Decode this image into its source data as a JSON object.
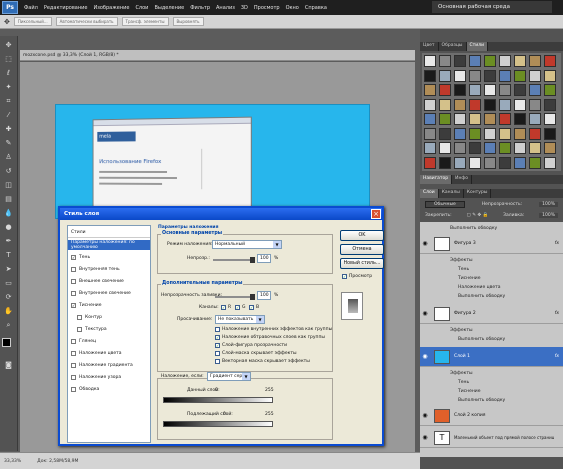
{
  "menubar": {
    "logo": "Ps",
    "items": [
      "Файл",
      "Редактирование",
      "Изображение",
      "Слои",
      "Выделение",
      "Фильтр",
      "Анализ",
      "3D",
      "Просмотр",
      "Окно",
      "Справка"
    ],
    "workspace": "Основная рабочая среда"
  },
  "options": {
    "items": [
      "Пиксельный...",
      "Автоматически выбирать",
      "Трансф. элементы",
      "Выровнять"
    ]
  },
  "document": {
    "tab_title": "mozxcone.psd @ 33,3% (Слой 1, RGB/8) *",
    "browser_logo": "mela",
    "browser_heading": "Использование Firefox",
    "zoom": "33,33%",
    "status": "Док: 2,58M/58,9M"
  },
  "styles_panel": {
    "tabs": [
      "Цвет",
      "Образцы",
      "Стили"
    ]
  },
  "navigator_panel": {
    "tabs": [
      "Навигатор",
      "Инфо"
    ]
  },
  "layers_panel": {
    "tabs": [
      "Слои",
      "Каналы",
      "Контуры"
    ],
    "blend_mode": "Обычные",
    "opacity_label": "Непрозрачность:",
    "opacity_value": "100%",
    "lock_label": "Закрепить:",
    "fill_label": "Заливка:",
    "fill_value": "100%",
    "rows": [
      {
        "name": "Фигура 3",
        "fx": "fx"
      },
      {
        "name": "Фигура 2",
        "fx": "fx"
      },
      {
        "name": "Слой 1",
        "fx": "fx"
      },
      {
        "name": "Слой 2 копия",
        "fx": ""
      },
      {
        "name": "Маленький объект под прямой полосе страницы",
        "fx": ""
      }
    ],
    "sub_top": "Выполнить обводку",
    "sub_effects": "Эффекты",
    "sub_shadow": "Тень",
    "sub_emboss": "Тиснение",
    "sub_color": "Наложение цвета",
    "sub_stroke": "Выполнить обводку"
  },
  "dialog": {
    "title": "Стиль слоя",
    "close": "×",
    "left_items": [
      {
        "label": "Стили",
        "checked": ""
      },
      {
        "label": "Параметры наложения: по умолчанию",
        "checked": ""
      },
      {
        "label": "Тень",
        "checked": "✓"
      },
      {
        "label": "Внутренняя тень",
        "checked": ""
      },
      {
        "label": "Внешнее свечение",
        "checked": ""
      },
      {
        "label": "Внутреннее свечение",
        "checked": ""
      },
      {
        "label": "Тиснение",
        "checked": "✓"
      },
      {
        "label": "Контур",
        "checked": ""
      },
      {
        "label": "Текстура",
        "checked": ""
      },
      {
        "label": "Глянец",
        "checked": ""
      },
      {
        "label": "Наложение цвета",
        "checked": ""
      },
      {
        "label": "Наложение градиента",
        "checked": ""
      },
      {
        "label": "Наложение узора",
        "checked": ""
      },
      {
        "label": "Обводка",
        "checked": ""
      }
    ],
    "section_title": "Параметры наложения",
    "basic_title": "Основные параметры",
    "blend_mode_label": "Режим наложения:",
    "blend_mode_value": "Нормальный",
    "opacity_label": "Непрозр.:",
    "opacity_value": "100",
    "percent": "%",
    "advanced_title": "Дополнительные параметры",
    "fill_opacity_label": "Непрозрачность заливки:",
    "fill_opacity_value": "100",
    "channels_label": "Каналы:",
    "channel_r": "R",
    "channel_g": "G",
    "channel_b": "B",
    "knockout_label": "Просачивание:",
    "knockout_value": "Не показывать",
    "opt1": "Наложение внутренних эффектов как группы",
    "opt2": "Наложение обтравочных слоев как группы",
    "opt3": "Слой-фигура прозрачности",
    "opt4": "Слой-маска скрывает эффекты",
    "opt5": "Векторная маска скрывает эффекты",
    "blend_if_label": "Наложение, если:",
    "blend_if_value": "Градиент сер...",
    "this_layer_label": "Данный слой:",
    "this_layer_min": "0",
    "this_layer_max": "255",
    "underlying_label": "Подлежащий слой:",
    "underlying_min": "0",
    "underlying_max": "255",
    "ok": "OK",
    "cancel": "Отмена",
    "new_style": "Новый стиль...",
    "preview_label": "Просмотр"
  }
}
